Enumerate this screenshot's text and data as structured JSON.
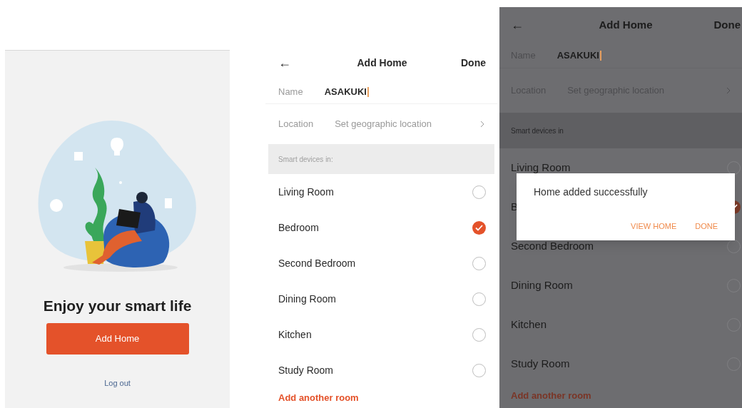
{
  "screens": [
    {
      "kind": "welcome",
      "title": "Enjoy your smart life",
      "primary_button": "Add Home",
      "link": "Log out"
    },
    {
      "kind": "form",
      "dimmed": false,
      "back": "←",
      "title": "Add Home",
      "action": "Done",
      "name_label": "Name",
      "name_value": "ASAKUKI",
      "location_label": "Location",
      "location_value": "Set geographic location",
      "section": "Smart devices in:",
      "rooms": [
        {
          "name": "Living Room",
          "checked": false
        },
        {
          "name": "Bedroom",
          "checked": true
        },
        {
          "name": "Second Bedroom",
          "checked": false
        },
        {
          "name": "Dining Room",
          "checked": false
        },
        {
          "name": "Kitchen",
          "checked": false
        },
        {
          "name": "Study Room",
          "checked": false
        }
      ],
      "add_room": "Add another room"
    },
    {
      "kind": "form",
      "dimmed": true,
      "back": "←",
      "title": "Add Home",
      "action": "Done",
      "name_label": "Name",
      "name_value": "ASAKUKI",
      "location_label": "Location",
      "location_value": "Set geographic location",
      "section": "Smart devices in",
      "rooms": [
        {
          "name": "Living Room",
          "checked": false
        },
        {
          "name": "B",
          "checked": true
        },
        {
          "name": "Second Bedroom",
          "checked": false
        },
        {
          "name": "Dining Room",
          "checked": false
        },
        {
          "name": "Kitchen",
          "checked": false
        },
        {
          "name": "Study Room",
          "checked": false
        }
      ],
      "add_room": "Add another room",
      "dialog": {
        "message": "Home added successfully",
        "buttons": [
          "VIEW HOME",
          "DONE"
        ]
      }
    }
  ]
}
